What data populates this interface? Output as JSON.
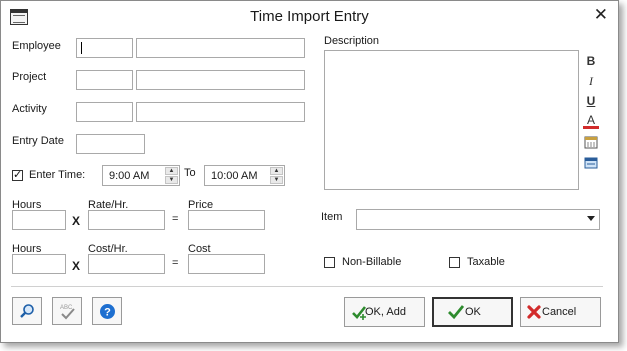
{
  "window": {
    "title": "Time Import Entry"
  },
  "labels": {
    "employee": "Employee",
    "project": "Project",
    "activity": "Activity",
    "entry_date": "Entry Date",
    "enter_time": "Enter Time:",
    "to": "To",
    "hours1": "Hours",
    "rate": "Rate/Hr.",
    "price": "Price",
    "hours2": "Hours",
    "cost_hr": "Cost/Hr.",
    "cost": "Cost",
    "times1": "X",
    "times2": "X",
    "equals1": "=",
    "equals2": "=",
    "description": "Description",
    "item": "Item",
    "non_billable": "Non-Billable",
    "taxable": "Taxable"
  },
  "time": {
    "start": "9:00 AM",
    "end": "10:00 AM",
    "enter_time_checked": true
  },
  "checkboxes": {
    "non_billable": false,
    "taxable": false
  },
  "buttons": {
    "ok_add": "OK, Add",
    "ok": "OK",
    "cancel": "Cancel"
  },
  "icons": {
    "app": "window-icon",
    "close": "close-icon",
    "search": "magnifier-icon",
    "spell": "spellcheck-icon",
    "help": "help-icon",
    "bold": "bold-icon",
    "italic": "italic-icon",
    "underline": "underline-icon",
    "font_color": "font-color-icon",
    "insert_date": "calendar-icon",
    "insert_time": "keyboard-icon"
  },
  "format_glyphs": {
    "bold": "B",
    "italic": "I",
    "underline": "U",
    "font_color": "A"
  },
  "colors": {
    "help_blue": "#1e6fd0",
    "ok_green": "#2e8b2e",
    "cancel_red": "#d22b2b"
  }
}
